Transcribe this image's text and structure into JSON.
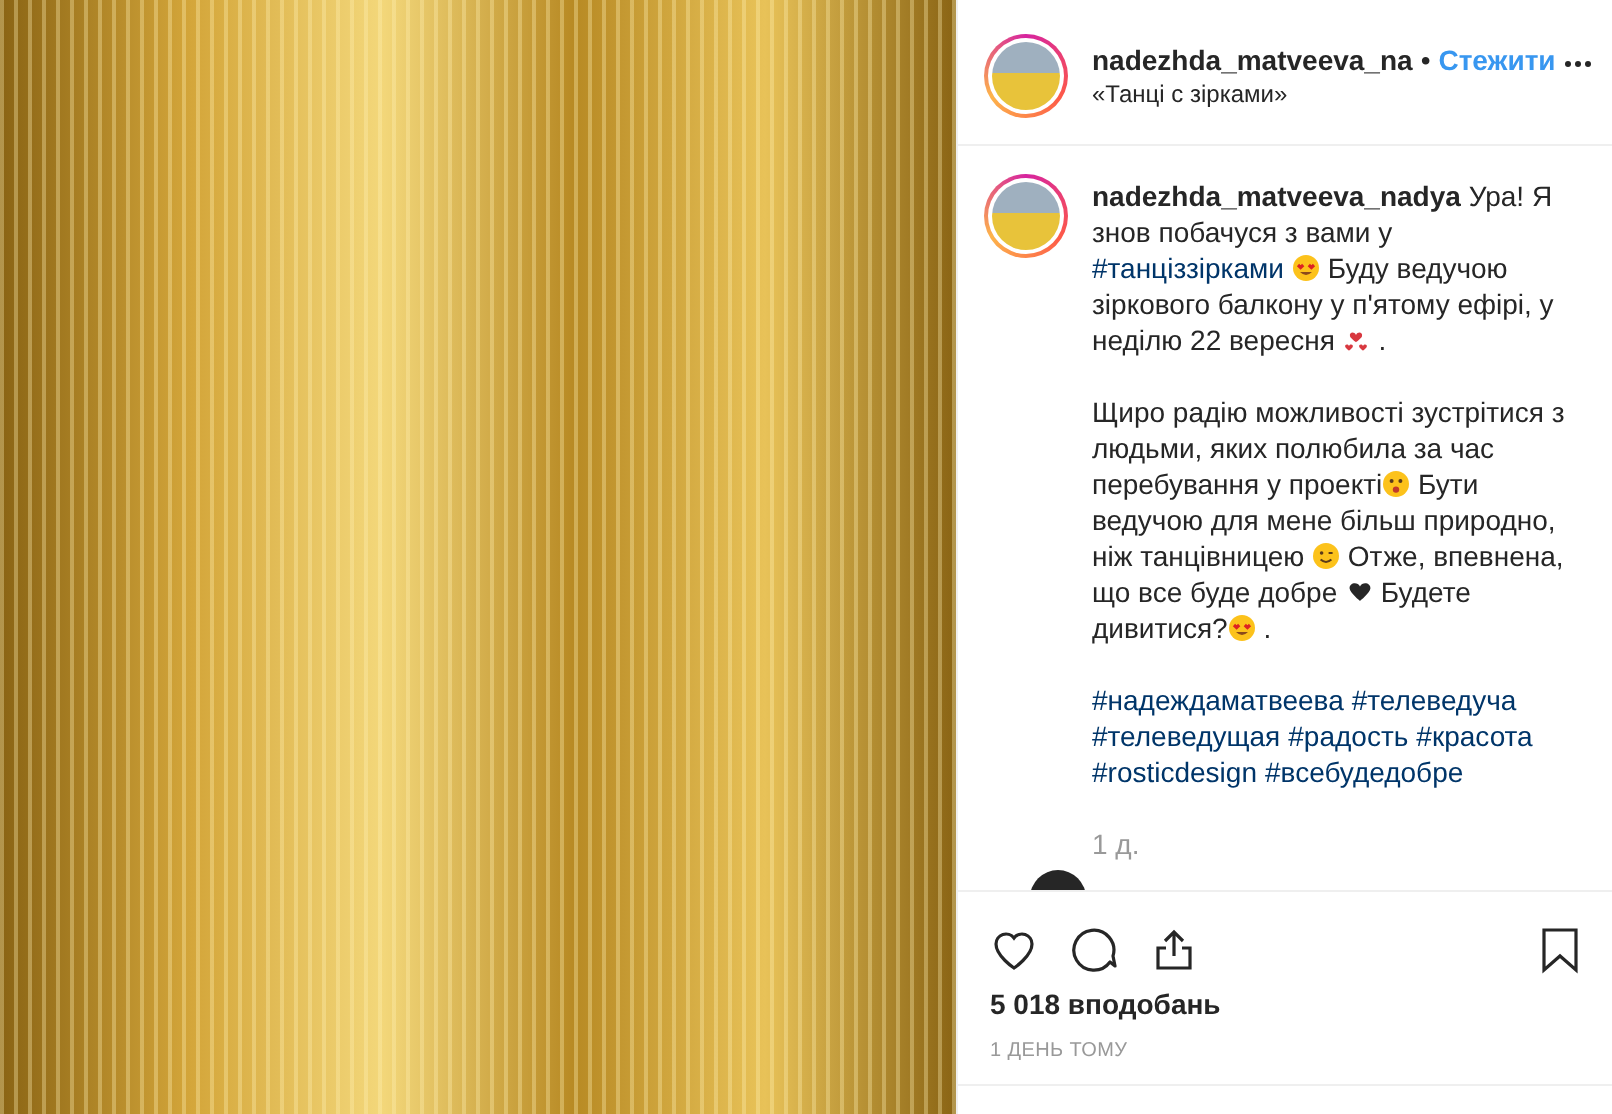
{
  "header": {
    "username": "nadezhda_matveeva_na",
    "separator": "•",
    "follow": "Стежити",
    "location": "«Танці с зірками»"
  },
  "caption": [
    [
      {
        "kind": "user",
        "text": "nadezhda_matveeva_nadya"
      },
      {
        "kind": "text",
        "text": " Ура! Я знов побачуся з вами у "
      },
      {
        "kind": "tag",
        "text": "#танціззірками"
      },
      {
        "kind": "hearteyes"
      },
      {
        "kind": "text",
        "text": " Буду ведучою зіркового балкону у п'ятому ефірі, у неділю 22 вересня "
      },
      {
        "kind": "hearts"
      },
      {
        "kind": "text",
        "text": " ."
      }
    ],
    [
      {
        "kind": "text",
        "text": "Щиро радію можливості зустрітися з людьми, яких полюбила за час перебування у проекті"
      },
      {
        "kind": "surprised"
      },
      {
        "kind": "text",
        "text": " Бути ведучою для мене більш природно, ніж танцівницею "
      },
      {
        "kind": "smile"
      },
      {
        "kind": "text",
        "text": " Отже, впевнена, що все буде добре "
      },
      {
        "kind": "heart"
      },
      {
        "kind": "text",
        "text": " Будете дивитися?"
      },
      {
        "kind": "hearteyes"
      },
      {
        "kind": "text",
        "text": " ."
      }
    ],
    [
      {
        "kind": "tag",
        "text": "#надеждаматвеева"
      },
      {
        "kind": "tag",
        "text": "#телеведуча"
      },
      {
        "kind": "tag",
        "text": "#телеведущая"
      },
      {
        "kind": "tag",
        "text": "#радость"
      },
      {
        "kind": "tag",
        "text": "#красота"
      },
      {
        "kind": "tag",
        "text": "#rosticdesign"
      },
      {
        "kind": "tag",
        "text": "#всебудедобре"
      }
    ]
  ],
  "caption_age": "1 д.",
  "likes": "5 018 вподобань",
  "timestamp": "1 ДЕНЬ ТОМУ"
}
